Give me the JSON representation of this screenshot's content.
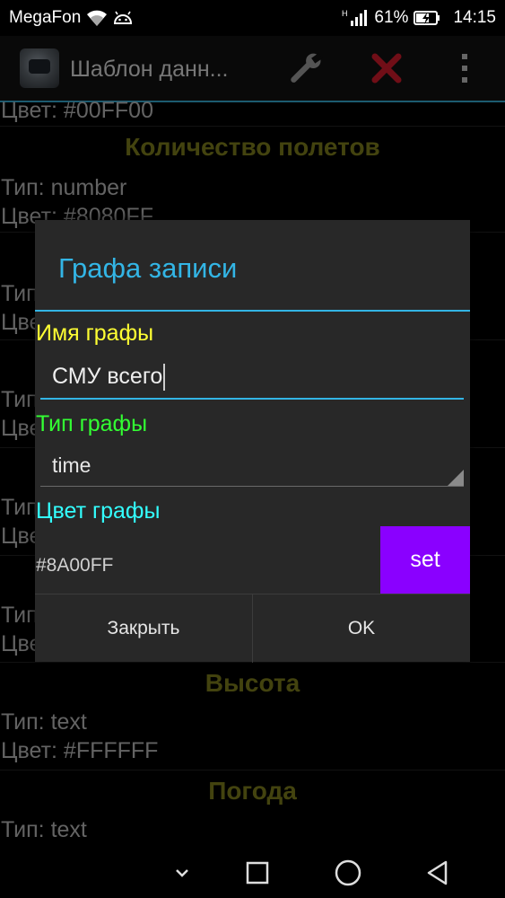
{
  "status_bar": {
    "carrier": "MegaFon",
    "battery": "61%",
    "time": "14:15",
    "icons": [
      "wifi-icon",
      "android-icon",
      "signal-icon",
      "battery-icon"
    ]
  },
  "action_bar": {
    "title": "Шаблон данн...",
    "icons": [
      "app-icon",
      "wrench-icon",
      "close-icon",
      "overflow-menu-icon"
    ],
    "accent": "#33a6cc",
    "delete_color": "#cc1b2a"
  },
  "background_list": {
    "rows": [
      {
        "text": "Цвет: #00FF00"
      },
      {
        "heading": "Количество полетов"
      },
      {
        "text": "Тип: number"
      },
      {
        "text": "Цвет: #8080FF"
      },
      {
        "text": "Тип"
      },
      {
        "text": "Цве"
      },
      {
        "text": "Тип"
      },
      {
        "text": "Цве"
      },
      {
        "text": "Тип"
      },
      {
        "text": "Цве"
      },
      {
        "text": "Тип"
      },
      {
        "text": "Цве"
      },
      {
        "heading": "Высота"
      },
      {
        "text": "Тип: text"
      },
      {
        "text": "Цвет: #FFFFFF"
      },
      {
        "heading": "Погода"
      },
      {
        "text": "Тип: text"
      }
    ]
  },
  "dialog": {
    "title": "Графа записи",
    "name_label": "Имя графы",
    "name_value": "СМУ всего",
    "type_label": "Тип графы",
    "type_value": "time",
    "color_label": "Цвет графы",
    "color_value": "#8A00FF",
    "set_label": "set",
    "close_label": "Закрыть",
    "ok_label": "OK",
    "colors": {
      "title": "#33b5e5",
      "name_label": "#ffff33",
      "type_label": "#33ff33",
      "color_label": "#33ffff",
      "set_button": "#8a00ff"
    }
  },
  "nav_bar": {
    "icons": [
      "hide-keyboard-icon",
      "recent-apps-icon",
      "home-icon",
      "back-icon"
    ]
  }
}
